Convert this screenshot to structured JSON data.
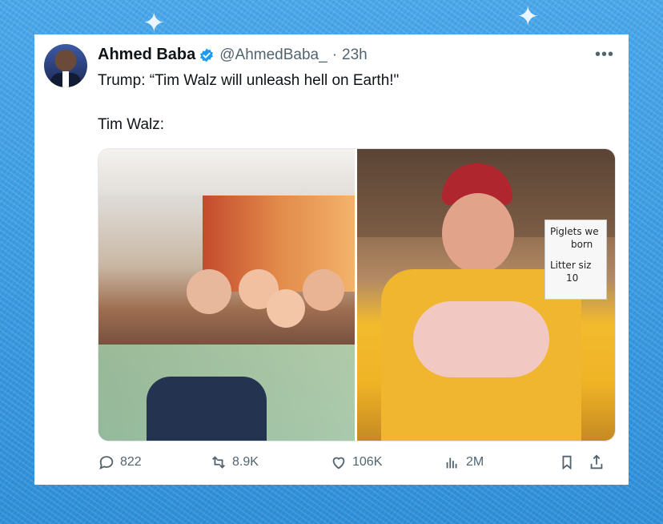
{
  "tweet": {
    "author_name": "Ahmed Baba",
    "handle": "@AhmedBaba_",
    "separator": "·",
    "time": "23h",
    "text_line1": "Trump: “Tim Walz will unleash hell on Earth!\"",
    "text_line2": "Tim Walz:",
    "more_icon": "more-horizontal-icon"
  },
  "media": {
    "left_alt": "",
    "right_alt": "",
    "right_sign": {
      "line1": "Piglets we",
      "line2": "born",
      "line3": "Litter siz",
      "line4": "10"
    }
  },
  "actions": {
    "replies": "822",
    "reposts": "8.9K",
    "likes": "106K",
    "views": "2M"
  },
  "colors": {
    "background": "#3f9ee3",
    "card": "#ffffff",
    "text_primary": "#0f1419",
    "text_secondary": "#536471",
    "verified": "#1d9bf0"
  }
}
